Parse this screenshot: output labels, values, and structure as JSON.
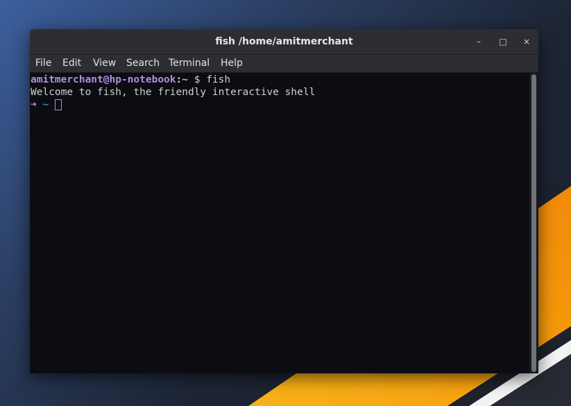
{
  "window": {
    "title": "fish  /home/amitmerchant",
    "controls": {
      "minimize": "–",
      "maximize": "□",
      "close": "×"
    }
  },
  "menubar": {
    "items": [
      "File",
      "Edit",
      "View",
      "Search",
      "Terminal",
      "Help"
    ]
  },
  "terminal": {
    "prompt_user": "amitmerchant@hp-notebook",
    "prompt_colon": ":",
    "prompt_dir": "~",
    "prompt_symbol": " $ ",
    "command": "fish",
    "output": "Welcome to fish, the friendly interactive shell",
    "fish_arrow": "➜",
    "fish_dir": "~"
  },
  "colors": {
    "prompt_user": "#b48ee3",
    "prompt_dir": "#e0c14a",
    "fish_dir": "#3fb8b0",
    "terminal_bg": "#0b0d12",
    "titlebar_bg": "#2c2e33",
    "wallpaper_accent": "#f5a50a"
  },
  "icons": {
    "minimize": "minimize-icon",
    "maximize": "maximize-icon",
    "close": "close-icon",
    "cursor": "block-cursor"
  }
}
